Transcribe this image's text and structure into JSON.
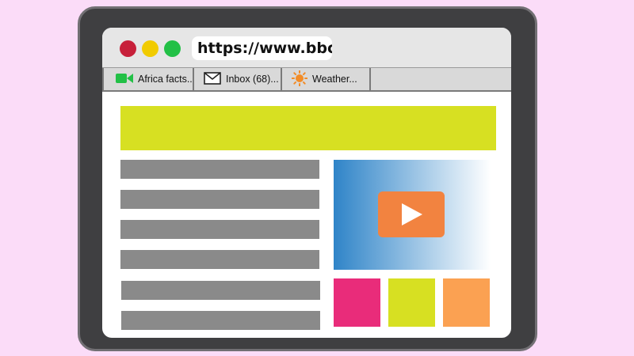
{
  "browser": {
    "url": "https://www.bbc.c",
    "window_controls": {
      "close_color": "#c7203a",
      "minimize_color": "#f1cb00",
      "maximize_color": "#22c046"
    }
  },
  "tabs": [
    {
      "label": "Africa facts...",
      "icon": "video-camera-icon",
      "icon_color": "#22c046"
    },
    {
      "label": "Inbox (68)...",
      "icon": "envelope-icon",
      "icon_color": "#222222"
    },
    {
      "label": "Weather...",
      "icon": "sun-icon",
      "icon_color": "#f28c28"
    }
  ],
  "page": {
    "banner_color": "#d7e022",
    "text_line_color": "#8a8a8a",
    "video": {
      "gradient_from": "#2f84c8",
      "gradient_to": "#ffffff",
      "play_button_color": "#f28340",
      "play_icon": "play-icon"
    },
    "thumbnails": [
      {
        "color": "#e92c7a"
      },
      {
        "color": "#d7e022"
      },
      {
        "color": "#fba152"
      }
    ]
  },
  "colors": {
    "background": "#fbdcf8",
    "device_frame": "#3f3f41",
    "device_border": "#727074"
  }
}
